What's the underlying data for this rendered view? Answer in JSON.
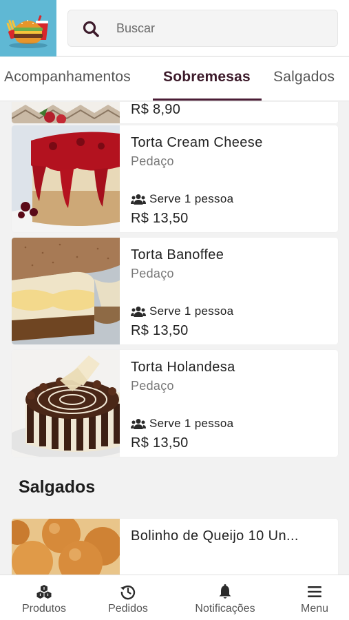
{
  "search": {
    "placeholder": "Buscar"
  },
  "tabs": [
    {
      "label": "Acompanhamentos"
    },
    {
      "label": "Sobremesas",
      "active": true
    },
    {
      "label": "Salgados"
    }
  ],
  "partial_item": {
    "price": "R$ 8,90"
  },
  "items": [
    {
      "name": "Torta Cream Cheese",
      "description": "Pedaço",
      "serves": "Serve 1 pessoa",
      "price": "R$ 13,50"
    },
    {
      "name": "Torta Banoffee",
      "description": "Pedaço",
      "serves": "Serve 1 pessoa",
      "price": "R$ 13,50"
    },
    {
      "name": "Torta Holandesa",
      "description": "Pedaço",
      "serves": "Serve 1 pessoa",
      "price": "R$ 13,50"
    }
  ],
  "section": {
    "title": "Salgados"
  },
  "salgados_items": [
    {
      "name": "Bolinho de Queijo 10 Un..."
    }
  ],
  "bottom_nav": [
    {
      "label": "Produtos",
      "icon": "boxes-icon"
    },
    {
      "label": "Pedidos",
      "icon": "history-icon"
    },
    {
      "label": "Notificações",
      "icon": "bell-icon"
    },
    {
      "label": "Menu",
      "icon": "hamburger-menu-icon"
    }
  ],
  "colors": {
    "accent": "#4a1c35",
    "logo_bg": "#5fb8d4"
  }
}
